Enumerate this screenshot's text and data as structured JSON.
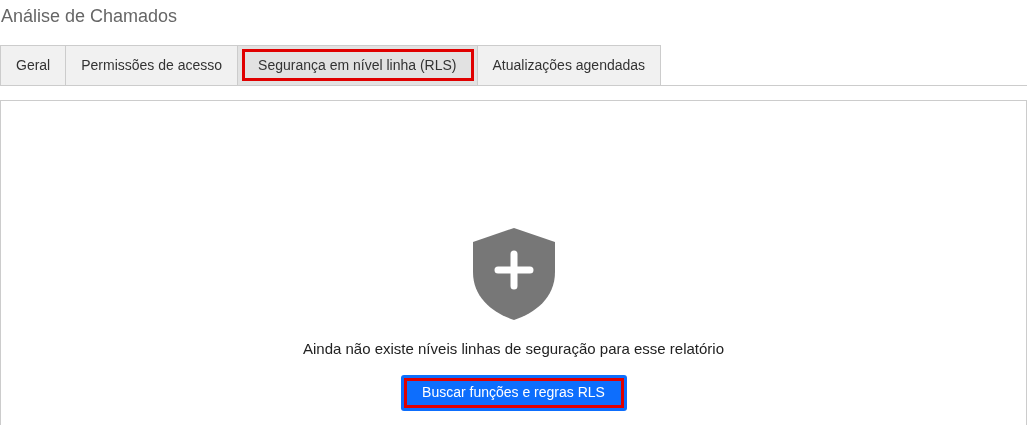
{
  "page_title": "Análise de Chamados",
  "tabs": [
    {
      "label": "Geral",
      "selected": false,
      "highlighted": false
    },
    {
      "label": "Permissões de acesso",
      "selected": false,
      "highlighted": false
    },
    {
      "label": "Segurança em nível linha (RLS)",
      "selected": true,
      "highlighted": true
    },
    {
      "label": "Atualizações agendadas",
      "selected": false,
      "highlighted": false
    }
  ],
  "empty_state": {
    "message": "Ainda não existe níveis linhas de seguração para esse relatório",
    "button": {
      "label": "Buscar funções e regras RLS",
      "highlighted": true
    }
  }
}
